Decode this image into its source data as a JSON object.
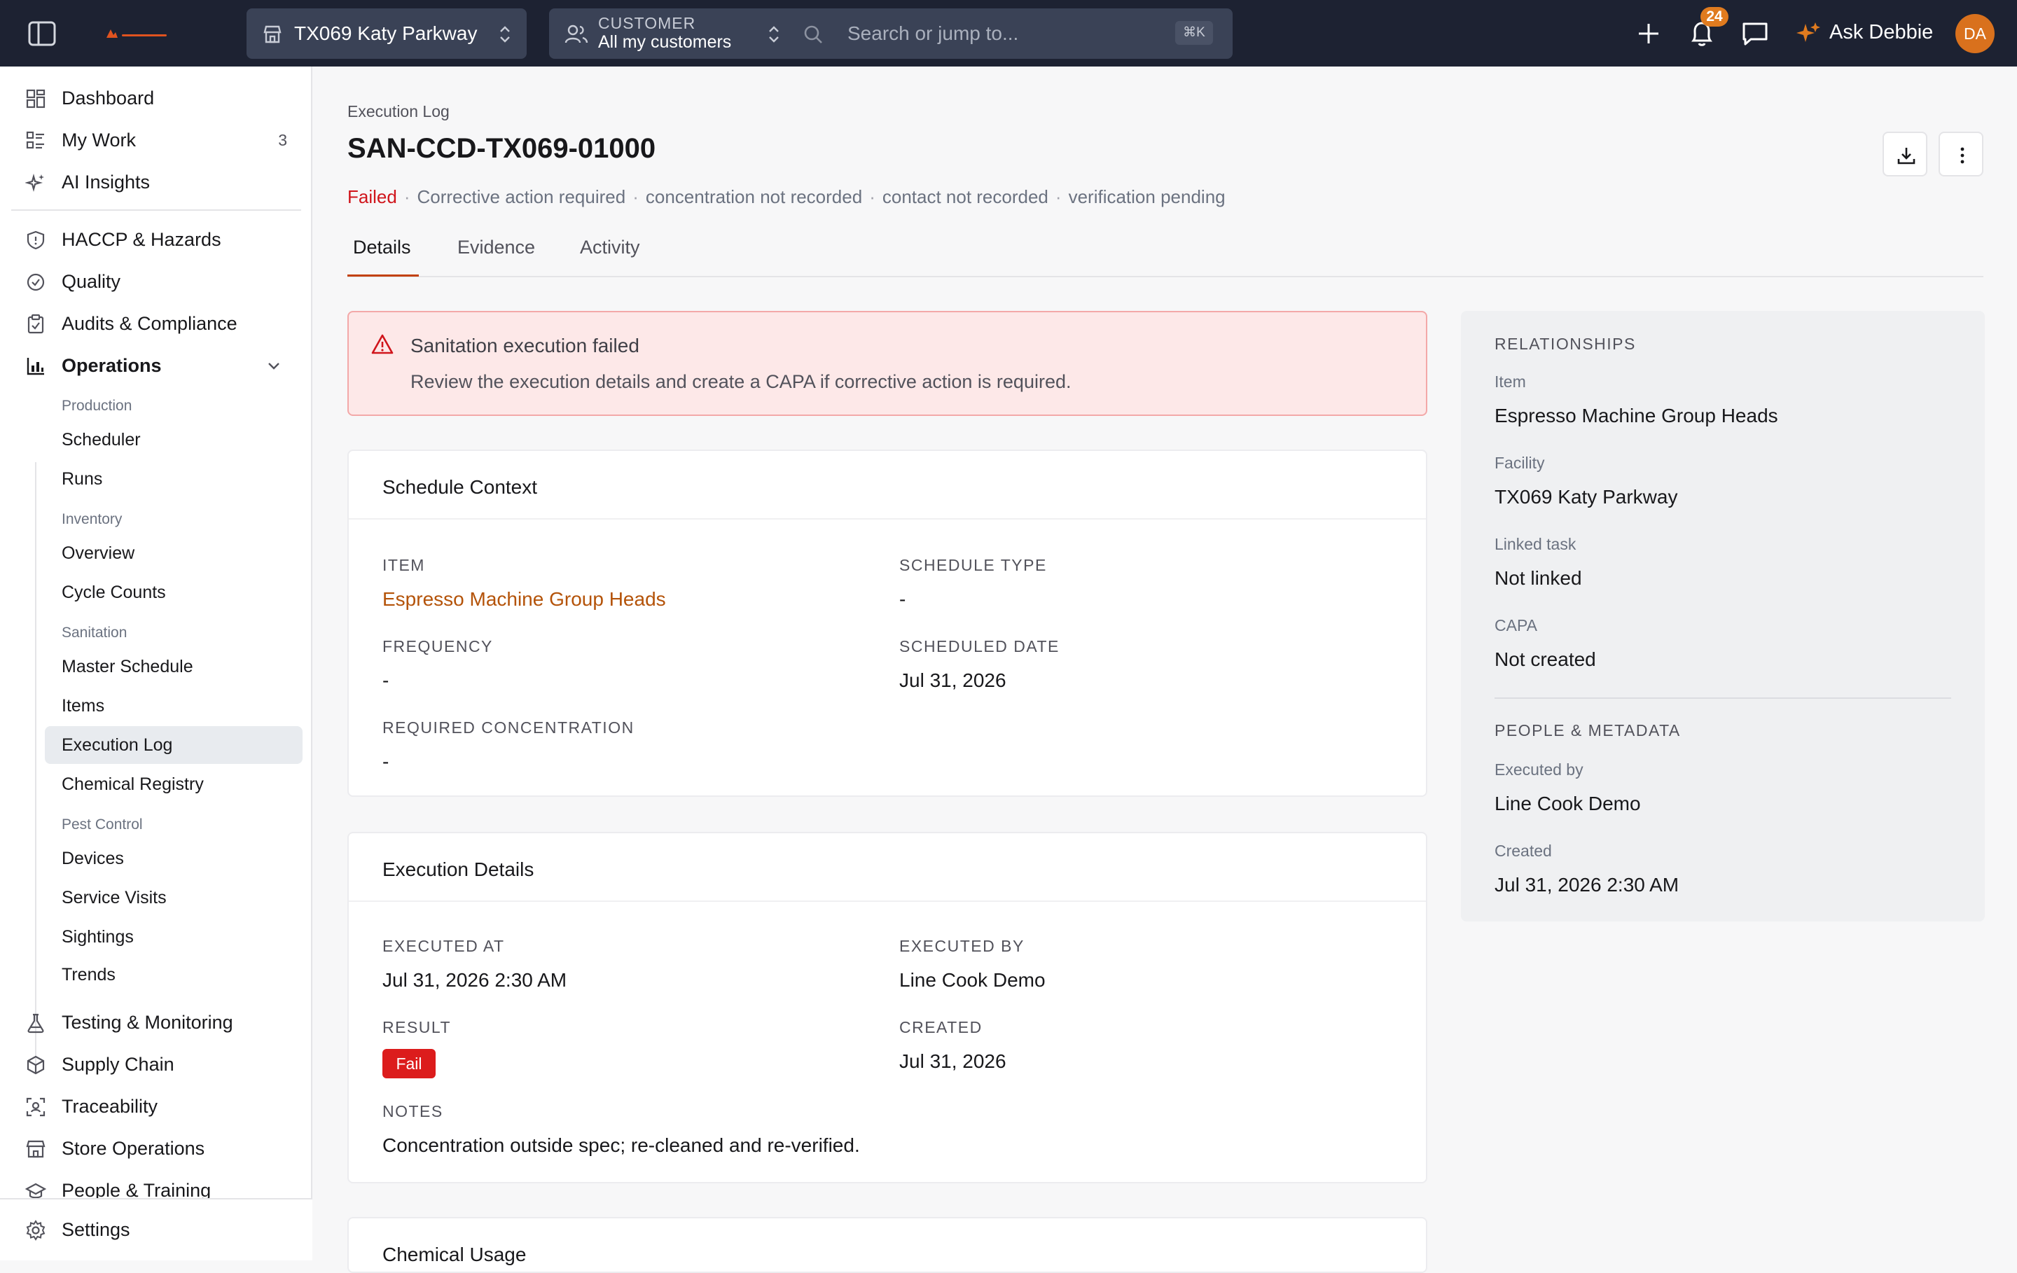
{
  "topbar": {
    "location": "TX069 Katy Parkway",
    "customer_label": "CUSTOMER",
    "customer_value": "All my customers",
    "search_placeholder": "Search or jump to...",
    "search_shortcut": "⌘K",
    "notification_count": "24",
    "ask_label": "Ask Debbie",
    "avatar_initials": "DA",
    "accent_color": "#e07b1f"
  },
  "sidebar": {
    "top_items": [
      {
        "label": "Dashboard",
        "icon": "grid-icon"
      },
      {
        "label": "My Work",
        "icon": "list-icon",
        "count": "3"
      },
      {
        "label": "AI Insights",
        "icon": "sparkle-icon"
      }
    ],
    "groups": [
      {
        "label": "HACCP & Hazards",
        "icon": "shield-icon"
      },
      {
        "label": "Quality",
        "icon": "check-circle-icon"
      },
      {
        "label": "Audits & Compliance",
        "icon": "clipboard-icon"
      },
      {
        "label": "Operations",
        "icon": "chart-icon"
      }
    ],
    "operations": {
      "production_label": "Production",
      "production": [
        "Scheduler",
        "Runs"
      ],
      "inventory_label": "Inventory",
      "inventory": [
        "Overview",
        "Cycle Counts"
      ],
      "sanitation_label": "Sanitation",
      "sanitation": [
        "Master Schedule",
        "Items",
        "Execution Log",
        "Chemical Registry"
      ],
      "pest_label": "Pest Control",
      "pest": [
        "Devices",
        "Service Visits",
        "Sightings",
        "Trends"
      ]
    },
    "bottom_items": [
      {
        "label": "Testing & Monitoring",
        "icon": "flask-icon"
      },
      {
        "label": "Supply Chain",
        "icon": "package-icon"
      },
      {
        "label": "Traceability",
        "icon": "scan-icon"
      },
      {
        "label": "Store Operations",
        "icon": "store-icon"
      },
      {
        "label": "People & Training",
        "icon": "graduation-icon"
      }
    ],
    "settings_label": "Settings"
  },
  "page": {
    "breadcrumb": "Execution Log",
    "title": "SAN-CCD-TX069-01000",
    "status": "Failed",
    "status_color": "#d0151c",
    "flags": [
      "Corrective action required",
      "concentration not recorded",
      "contact not recorded",
      "verification pending"
    ],
    "tabs": [
      "Details",
      "Evidence",
      "Activity"
    ]
  },
  "alert": {
    "title": "Sanitation execution failed",
    "description": "Review the execution details and create a CAPA if corrective action is required."
  },
  "schedule_context": {
    "title": "Schedule Context",
    "item_label": "ITEM",
    "item_value": "Espresso Machine Group Heads",
    "schedule_type_label": "SCHEDULE TYPE",
    "schedule_type_value": "-",
    "frequency_label": "FREQUENCY",
    "frequency_value": "-",
    "scheduled_date_label": "SCHEDULED DATE",
    "scheduled_date_value": "Jul 31, 2026",
    "required_conc_label": "REQUIRED CONCENTRATION",
    "required_conc_value": "-"
  },
  "execution_details": {
    "title": "Execution Details",
    "executed_at_label": "EXECUTED AT",
    "executed_at_value": "Jul 31, 2026 2:30 AM",
    "executed_by_label": "EXECUTED BY",
    "executed_by_value": "Line Cook Demo",
    "result_label": "RESULT",
    "result_value": "Fail",
    "created_label": "CREATED",
    "created_value": "Jul 31, 2026",
    "notes_label": "NOTES",
    "notes_value": "Concentration outside spec; re-cleaned and re-verified."
  },
  "chemical_usage": {
    "title": "Chemical Usage"
  },
  "relationships": {
    "heading": "RELATIONSHIPS",
    "item_label": "Item",
    "item_value": "Espresso Machine Group Heads",
    "facility_label": "Facility",
    "facility_value": "TX069 Katy Parkway",
    "task_label": "Linked task",
    "task_value": "Not linked",
    "capa_label": "CAPA",
    "capa_value": "Not created",
    "people_heading": "PEOPLE & METADATA",
    "executed_by_label": "Executed by",
    "executed_by_value": "Line Cook Demo",
    "created_label": "Created",
    "created_value": "Jul 31, 2026 2:30 AM"
  }
}
